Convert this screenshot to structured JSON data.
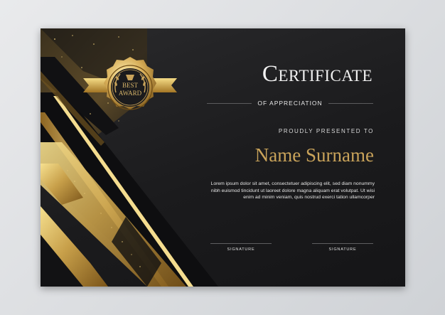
{
  "certificate": {
    "title": "Certificate",
    "subtitle": "OF APPRECIATION",
    "presented_label": "PROUDLY PRESENTED TO",
    "recipient_name": "Name Surname",
    "description": "Lorem ipsum dolor sit amet, consectetuer adipiscing elit, sed diam nonummy nibh euismod tincidunt ut laoreet dolore magna aliquam erat volutpat. Ut wisi enim ad minim veniam, quis nostrud exerci tation ullamcorper",
    "signatures": [
      {
        "label": "SIGNATURE"
      },
      {
        "label": "SIGNATURE"
      }
    ]
  },
  "badge": {
    "line1": "BEST",
    "line2": "AWARD"
  },
  "colors": {
    "gold": "#c9a35a",
    "gold_light": "#f3dc8c",
    "gold_dark": "#8a6420",
    "background": "#1e1e20",
    "frame": "#dcdee1"
  }
}
